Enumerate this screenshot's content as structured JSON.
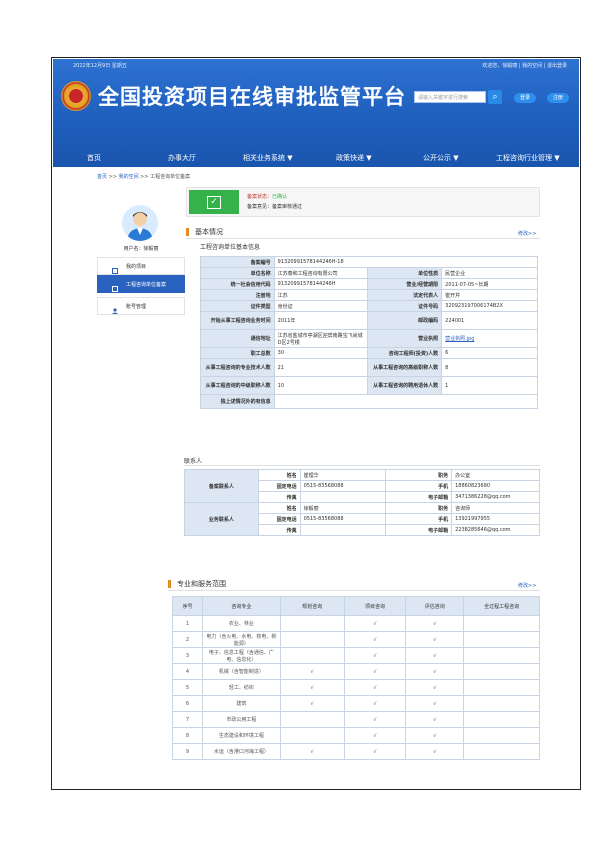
{
  "header": {
    "date": "2022年12月9日 星期五",
    "top_links": "欢迎您，徐毅丽 | 我的空间 | 退出登录",
    "title": "全国投资项目在线审批监管平台",
    "search_placeholder": "请输入关键字进行搜索",
    "login": "登录",
    "register": "注册"
  },
  "nav": [
    "首页",
    "办事大厅",
    "相关业务系统 ▼",
    "政策快递 ▼",
    "公开公示 ▼",
    "工程咨询行业管理 ▼"
  ],
  "breadcrumb": {
    "home": "首页",
    "sep1": " >> ",
    "space": "我的空间",
    "sep2": " >> ",
    "current": "工程咨询单位备案"
  },
  "sidebar": {
    "user": "用户名：徐毅丽",
    "items": [
      "我的项目",
      "工程咨询单位备案",
      "账号管理"
    ]
  },
  "status": {
    "state_label": "备案状态：",
    "state_value": "已确认",
    "opinion_label": "备案意见：",
    "opinion_value": "备案审核通过"
  },
  "basic": {
    "section": "基本情况",
    "more": "修改>>",
    "subtitle": "工程咨询单位基本信息",
    "rows": [
      {
        "k1": "备案编号",
        "v1": "91320991578144246H-18"
      },
      {
        "k1": "单位名称",
        "v1": "江苏泰和工程咨询有限公司",
        "k2": "单位性质",
        "v2": "民营企业"
      },
      {
        "k1": "统一社会信用代码",
        "v1": "91320991578144246H",
        "k2": "营业/经营期限",
        "v2": "2011-07-05~长期"
      },
      {
        "k1": "注册地",
        "v1": "江苏",
        "k2": "法定代表人",
        "v2": "崔开芹"
      },
      {
        "k1": "证件类型",
        "v1": "身份证",
        "k2": "证件号码",
        "v2": "320923197006174B2X"
      },
      {
        "k1": "开始从事工程咨询业务时间",
        "v1": "2011年",
        "k2": "邮政编码",
        "v2": "224001"
      },
      {
        "k1": "通信地址",
        "v1": "江苏省盐城市亭湖区迎宾南路宝飞尚城D区2号楼",
        "k2": "营业执照",
        "v2": "营业执照.jpg"
      },
      {
        "k1": "职工总数",
        "v1": "30",
        "k2": "咨询工程师(投资)人数",
        "v2": "6"
      },
      {
        "k1": "从事工程咨询的专业技术人数",
        "v1": "21",
        "k2": "从事工程咨询的高级职称人数",
        "v2": "8"
      },
      {
        "k1": "从事工程咨询的中级职称人数",
        "v1": "10",
        "k2": "从事工程咨询的聘用退休人数",
        "v2": "1"
      },
      {
        "k1": "独上述情况外的有信息",
        "v1": ""
      }
    ]
  },
  "contacts": {
    "section": "联系人",
    "groups": [
      {
        "role": "备案联系人",
        "name_k": "姓名",
        "name": "崔理华",
        "title_k": "职务",
        "title": "办公室",
        "phone_k": "固定电话",
        "phone": "0515-83568088",
        "mobile_k": "手机",
        "mobile": "18860823680",
        "fax_k": "传真",
        "fax": "",
        "email_k": "电子邮箱",
        "email": "3471386228@qq.com"
      },
      {
        "role": "业务联系人",
        "name_k": "姓名",
        "name": "徐毅丽",
        "title_k": "职务",
        "title": "咨询师",
        "phone_k": "固定电话",
        "phone": "0515-83568088",
        "mobile_k": "手机",
        "mobile": "13921997955",
        "fax_k": "传真",
        "fax": "",
        "email_k": "电子邮箱",
        "email": "2238285646@qq.com"
      }
    ]
  },
  "scope": {
    "section": "专业和服务范围",
    "more": "修改>>",
    "headers": [
      "序号",
      "咨询专业",
      "规划咨询",
      "项目咨询",
      "评估咨询",
      "全过程工程咨询"
    ],
    "check": "√",
    "rows": [
      {
        "no": "1",
        "name": "农业、林业",
        "c": [
          false,
          true,
          true,
          false
        ]
      },
      {
        "no": "2",
        "name": "电力（含火电、水电、核电、新能源）",
        "c": [
          false,
          true,
          true,
          false
        ]
      },
      {
        "no": "3",
        "name": "电子、信息工程（含通信、广电、信息化）",
        "c": [
          false,
          true,
          true,
          false
        ]
      },
      {
        "no": "4",
        "name": "机械（含智能制造）",
        "c": [
          true,
          true,
          true,
          false
        ]
      },
      {
        "no": "5",
        "name": "轻工、纺织",
        "c": [
          true,
          true,
          true,
          false
        ]
      },
      {
        "no": "6",
        "name": "建筑",
        "c": [
          true,
          true,
          true,
          false
        ]
      },
      {
        "no": "7",
        "name": "市政公用工程",
        "c": [
          false,
          true,
          true,
          false
        ]
      },
      {
        "no": "8",
        "name": "生态建设和环境工程",
        "c": [
          false,
          true,
          true,
          false
        ]
      },
      {
        "no": "9",
        "name": "水运（含港口河海工程）",
        "c": [
          true,
          true,
          true,
          false
        ]
      }
    ]
  }
}
